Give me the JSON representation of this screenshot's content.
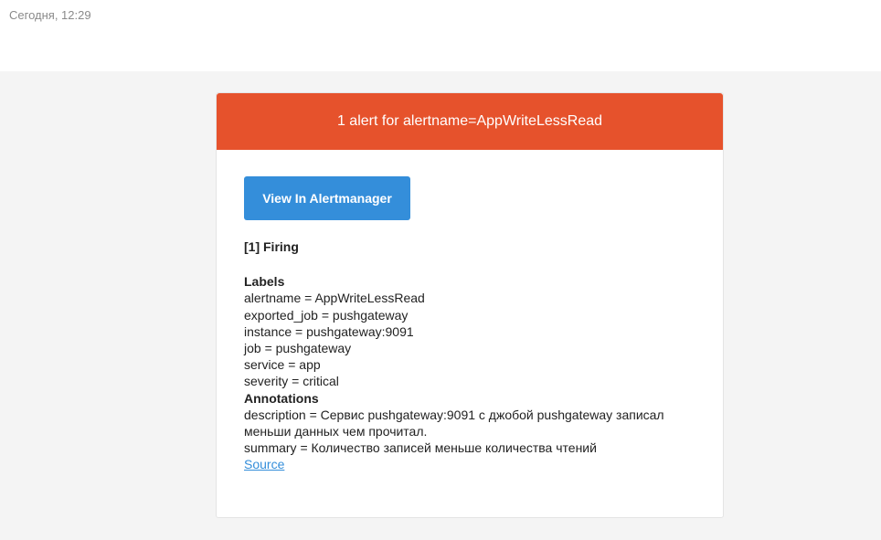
{
  "timestamp": "Сегодня, 12:29",
  "header": {
    "title": "1 alert for alertname=AppWriteLessRead",
    "color": "#e6522c"
  },
  "button": {
    "label": "View In Alertmanager",
    "color": "#348eda"
  },
  "firing": "[1] Firing",
  "labels_heading": "Labels",
  "labels": [
    "alertname = AppWriteLessRead",
    "exported_job = pushgateway",
    "instance = pushgateway:9091",
    "job = pushgateway",
    "service = app",
    "severity = critical"
  ],
  "annotations_heading": "Annotations",
  "annotations": {
    "description": "description = Сервис pushgateway:9091 с джобой pushgateway записал меньши данных чем прочитал.",
    "summary": "summary = Количество записей меньше количества чтений"
  },
  "source_link": "Source"
}
